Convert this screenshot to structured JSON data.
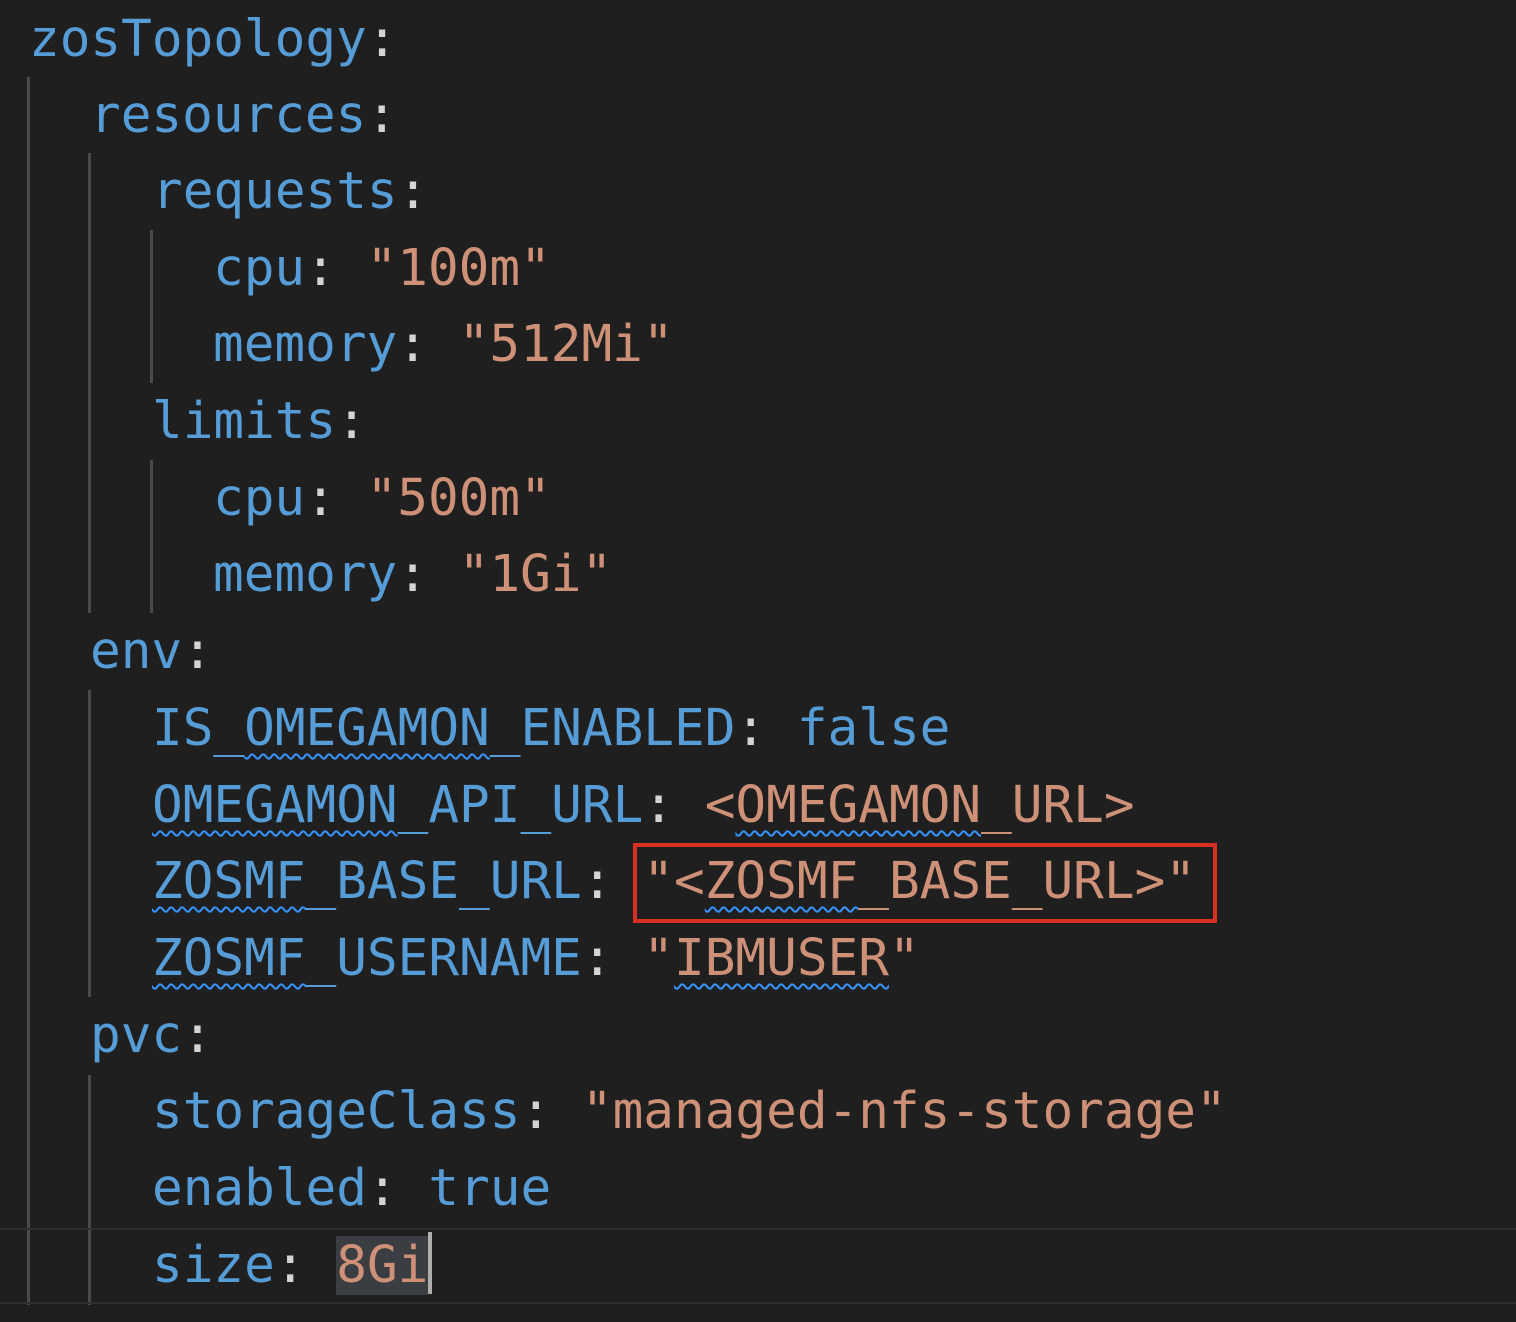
{
  "editor": {
    "lines": {
      "l1": {
        "key": "zosTopology",
        "colon": ":"
      },
      "l2": {
        "key": "resources",
        "colon": ":"
      },
      "l3": {
        "key": "requests",
        "colon": ":"
      },
      "l4": {
        "key": "cpu",
        "colon": ": ",
        "value": "\"100m\""
      },
      "l5": {
        "key": "memory",
        "colon": ": ",
        "value": "\"512Mi\""
      },
      "l6": {
        "key": "limits",
        "colon": ":"
      },
      "l7": {
        "key": "cpu",
        "colon": ": ",
        "value": "\"500m\""
      },
      "l8": {
        "key": "memory",
        "colon": ": ",
        "value": "\"1Gi\""
      },
      "l9": {
        "key": "env",
        "colon": ":"
      },
      "l10": {
        "key_a": "IS_",
        "key_b": "OMEGAMON",
        "key_c": "_ENABLED",
        "colon": ": ",
        "value": "false"
      },
      "l11": {
        "key_a": "OMEGAMON",
        "key_b": "_API_URL",
        "colon": ": ",
        "value_a": "<",
        "value_b": "OMEGAMON",
        "value_c": "_URL>"
      },
      "l12": {
        "key_a": "ZOSMF",
        "key_b": "_BASE_URL",
        "colon": ": ",
        "value_a": "\"<",
        "value_b": "ZOSMF",
        "value_c": "_BASE_URL>\""
      },
      "l13": {
        "key_a": "ZOSMF",
        "key_b": "_USERNAME",
        "colon": ": ",
        "value_a": "\"",
        "value_b": "IBMUSER",
        "value_c": "\""
      },
      "l14": {
        "key": "pvc",
        "colon": ":"
      },
      "l15": {
        "key": "storageClass",
        "colon": ": ",
        "value": "\"managed-nfs-storage\""
      },
      "l16": {
        "key": "enabled",
        "colon": ": ",
        "value": "true"
      },
      "l17": {
        "key": "size",
        "colon": ": ",
        "value": "8Gi"
      }
    },
    "colors": {
      "background": "#1f1f1f",
      "key": "#569cd6",
      "string": "#ce9178",
      "punctuation": "#d4d4d4",
      "squiggle": "#3794ff",
      "highlight_box": "#d93025"
    }
  }
}
